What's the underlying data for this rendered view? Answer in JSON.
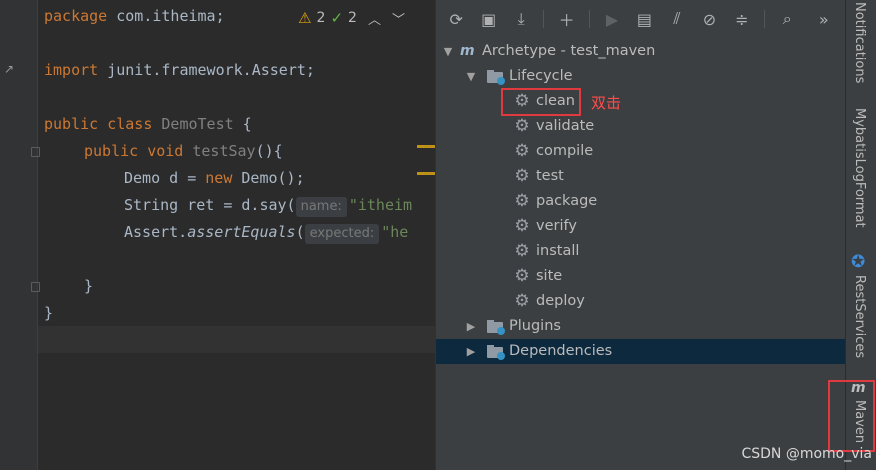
{
  "editor": {
    "lines": {
      "package_kw": "package",
      "package_name": " com.itheima;",
      "import_kw": "import",
      "import_name": " junit.framework.Assert;",
      "l3_public": "public",
      "l3_class": " class ",
      "l3_name": "DemoTest",
      "l3_brace": " {",
      "l4_public": "public",
      "l4_void": " void ",
      "l4_name": "testSay",
      "l4_rest": "(){",
      "l5_a": "Demo d = ",
      "l5_new": "new",
      "l5_b": " Demo();",
      "l6_a": "String ret = d.say(",
      "l6_hint": "name:",
      "l6_str": "\"itheim",
      "l7_a": "Assert.",
      "l7_b": "assertEquals",
      "l7_c": "(",
      "l7_hint": "expected:",
      "l7_str": "\"he",
      "l9": "}",
      "l10": "}"
    },
    "inspections": {
      "warnings": "2",
      "weak_warnings": "2"
    }
  },
  "maven": {
    "project": "Archetype - test_maven",
    "lifecycle_label": "Lifecycle",
    "goals": [
      "clean",
      "validate",
      "compile",
      "test",
      "package",
      "verify",
      "install",
      "site",
      "deploy"
    ],
    "plugins_label": "Plugins",
    "dependencies_label": "Dependencies",
    "annotation": "双击"
  },
  "sidebar": {
    "notifications": "Notifications",
    "mybatis": "MybatisLogFormat",
    "rest": "RestServices",
    "maven": "Maven"
  },
  "watermark": "CSDN @momo_via",
  "colors": {
    "selection": "#0d293e",
    "highlight_red": "#e0393e",
    "keyword": "#cc7832",
    "string": "#6a8759"
  }
}
